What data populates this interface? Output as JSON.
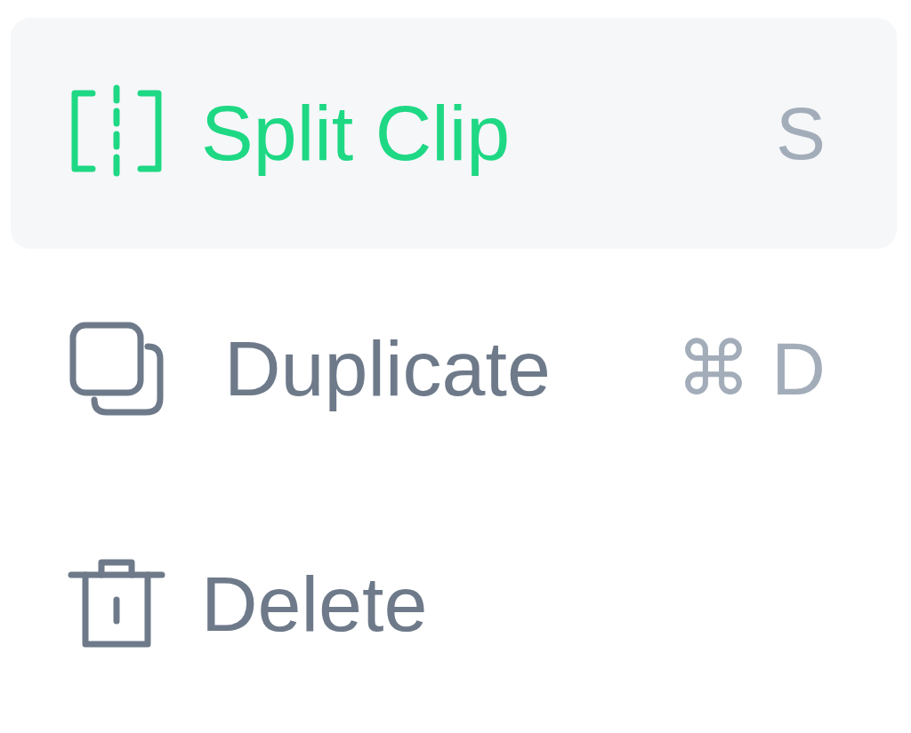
{
  "menu": {
    "items": [
      {
        "label": "Split Clip",
        "shortcut": "S",
        "selected": true
      },
      {
        "label": "Duplicate",
        "shortcut": "⌘ D",
        "selected": false
      },
      {
        "label": "Delete",
        "selected": false
      }
    ]
  }
}
